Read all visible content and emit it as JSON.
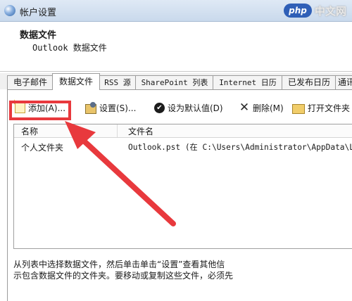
{
  "window": {
    "title": "帐户设置"
  },
  "watermark": {
    "logo": "php",
    "text": "中文网"
  },
  "header": {
    "title": "数据文件",
    "subtitle": "Outlook 数据文件"
  },
  "tabs": [
    {
      "label": "电子邮件"
    },
    {
      "label": "数据文件",
      "active": true
    },
    {
      "label": "RSS 源"
    },
    {
      "label": "SharePoint 列表"
    },
    {
      "label": "Internet 日历"
    },
    {
      "label": "已发布日历"
    },
    {
      "label": "通讯"
    }
  ],
  "toolbar": {
    "add": "添加(A)...",
    "settings": "设置(S)...",
    "set_default": "设为默认值(D)",
    "delete": "删除(M)",
    "open_location": "打开文件夹"
  },
  "table": {
    "columns": [
      "名称",
      "文件名"
    ],
    "rows": [
      {
        "name": "个人文件夹",
        "file": "Outlook.pst (在 C:\\Users\\Administrator\\AppData\\Lo"
      }
    ]
  },
  "description": {
    "line1": "从列表中选择数据文件，然后单击单击“设置”查看其他信",
    "line2": "示包含数据文件的文件夹。要移动或复制这些文件，必须先"
  },
  "annotation": {
    "color": "#e8393d"
  }
}
